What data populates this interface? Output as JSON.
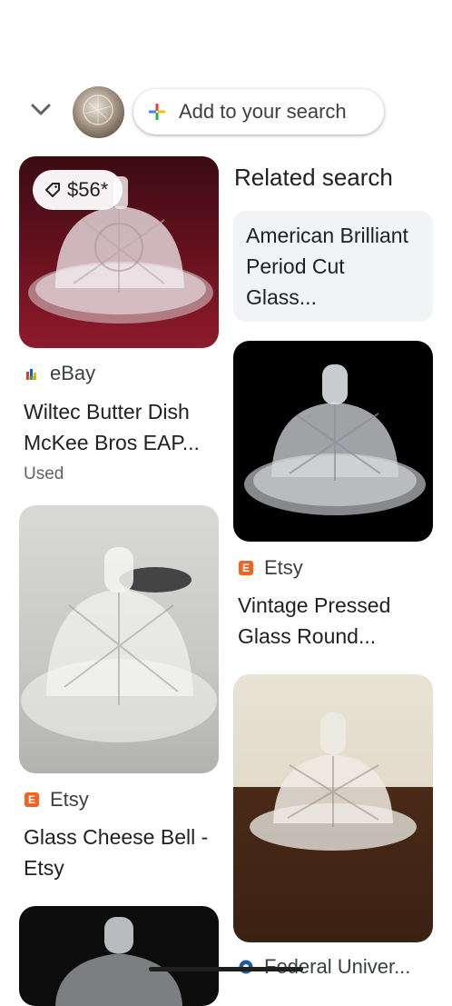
{
  "header": {
    "add_chip_label": "Add to your search"
  },
  "related": {
    "heading": "Related search",
    "query": "American Brilliant Period Cut Glass..."
  },
  "results": [
    {
      "source": "eBay",
      "title": "Wiltec Butter Dish McKee Bros EAP...",
      "condition": "Used",
      "price": "$56*"
    },
    {
      "source": "Etsy",
      "title": "Vintage Pressed Glass Round..."
    },
    {
      "source": "Etsy",
      "title": "Glass Cheese Bell - Etsy"
    },
    {
      "source": "Federal Univer...",
      "title": ""
    }
  ],
  "colors": {
    "etsy": "#f1641e",
    "google_blue": "#4285f4",
    "google_red": "#ea4335",
    "google_yellow": "#fbbc04",
    "google_green": "#34a853"
  }
}
